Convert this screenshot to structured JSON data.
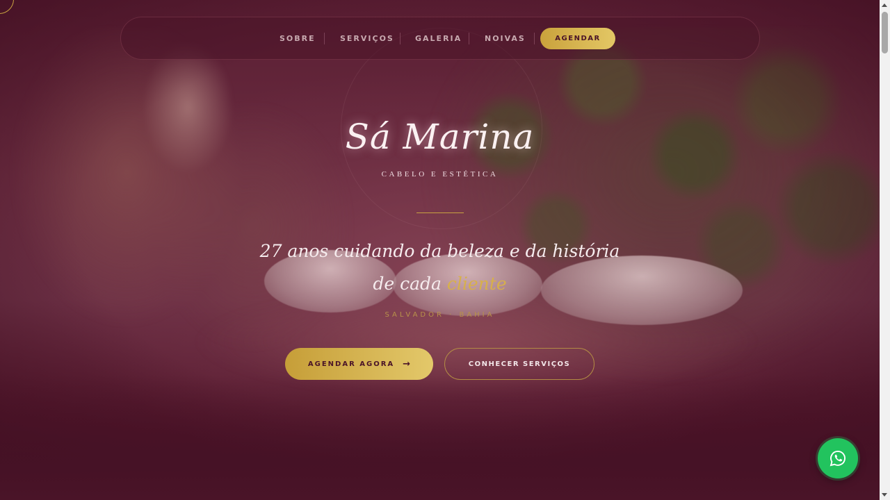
{
  "nav": {
    "links": [
      "SOBRE",
      "SERVIÇOS",
      "GALERIA",
      "NOIVAS"
    ],
    "cta": "AGENDAR"
  },
  "hero": {
    "logo": "Sá Marina",
    "tagline": "CABELO E ESTÉTICA",
    "headline_main": "27 anos cuidando da beleza e da história de cada",
    "headline_accent": "cliente",
    "location": "SALVADOR · BAHIA",
    "primary_button": "AGENDAR AGORA",
    "primary_arrow": "→",
    "secondary_button": "CONHECER SERVIÇOS"
  },
  "floating": {
    "icon": "whatsapp-icon",
    "color": "#22c35e"
  },
  "colors": {
    "accent_gold": "#d7b04a",
    "brand_wine": "#4a1428"
  }
}
